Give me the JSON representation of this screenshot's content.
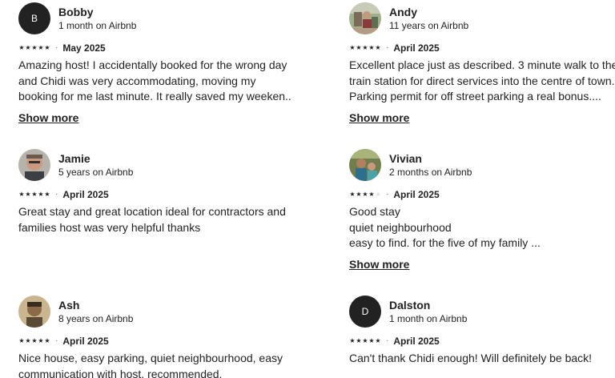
{
  "reviews": [
    {
      "name": "Bobby",
      "tenure": "1 month on Airbnb",
      "initial": "B",
      "avatar_icon": "initial-avatar",
      "rating": 5,
      "date": "May 2025",
      "lines": [
        "Amazing host! I accidentally booked for the wrong day",
        "and Chidi was very accommodating, moving my",
        "booking for me last minute. It really saved my weeken..."
      ],
      "more_label": "Show more"
    },
    {
      "name": "Andy",
      "tenure": "11 years on Airbnb",
      "initial": "",
      "avatar_icon": "photo-avatar",
      "rating": 5,
      "date": "April 2025",
      "lines": [
        "Excellent place just as described. 3 minute walk to the",
        "train station for direct services into the centre of town.",
        "Parking permit for off street parking a real bonus...."
      ],
      "more_label": "Show more"
    },
    {
      "name": "Jamie",
      "tenure": "5 years on Airbnb",
      "initial": "",
      "avatar_icon": "photo-avatar",
      "rating": 5,
      "date": "April 2025",
      "lines": [
        "Great stay and great location ideal for contractors and",
        "families host was very helpful thanks"
      ],
      "more_label": ""
    },
    {
      "name": "Vivian",
      "tenure": "2 months on Airbnb",
      "initial": "",
      "avatar_icon": "photo-avatar",
      "rating": 4,
      "date": "April 2025",
      "lines": [
        "Good stay",
        "quiet neighbourhood",
        "easy to find. for the five  of my family ..."
      ],
      "more_label": "Show more"
    },
    {
      "name": "Ash",
      "tenure": "8 years on Airbnb",
      "initial": "",
      "avatar_icon": "photo-avatar",
      "rating": 5,
      "date": "April 2025",
      "lines": [
        "Nice house, easy parking, quiet neighbourhood, easy",
        "communication with host, recommended."
      ],
      "more_label": ""
    },
    {
      "name": "Dalston",
      "tenure": "1 month on Airbnb",
      "initial": "D",
      "avatar_icon": "initial-avatar",
      "rating": 5,
      "date": "April 2025",
      "lines": [
        "Can't thank Chidi enough! Will definitely be back!"
      ],
      "more_label": ""
    }
  ],
  "separator": "·",
  "star_glyph": "★",
  "colors": {
    "text": "#222222",
    "star_off": "#dddddd",
    "muted": "#6a6a6a"
  }
}
